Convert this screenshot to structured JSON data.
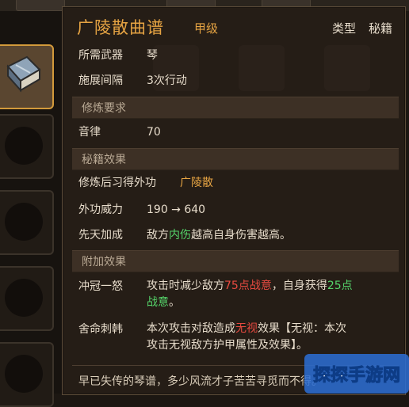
{
  "item": {
    "title": "广陵散曲谱",
    "grade": "甲级",
    "type_label": "类型",
    "type_value": "秘籍"
  },
  "basic": [
    {
      "key": "所需武器",
      "value": "琴"
    },
    {
      "key": "施展间隔",
      "value": "3次行动"
    }
  ],
  "sections": {
    "practice": "修炼要求",
    "secret_effect": "秘籍效果",
    "extra_effect": "附加效果"
  },
  "practice": {
    "key": "音律",
    "value": "70"
  },
  "secret": {
    "learn_key": "修炼后习得外功",
    "learn_value": "广陵散",
    "power_key": "外功威力",
    "power_value": "190 → 640",
    "innate_key": "先天加成",
    "innate_pre": "敌方",
    "innate_hl": "内伤",
    "innate_post": "越高自身伤害越高。"
  },
  "extra": {
    "e1_key": "冲冠一怒",
    "e1_a": "攻击时减少敌方",
    "e1_b": "75点战意",
    "e1_c": "，自身获得",
    "e1_d": "25点",
    "e1_e": "战意",
    "e1_f": "。",
    "e2_key": "舍命刺韩",
    "e2_a": "本次攻击对敌造成",
    "e2_b": "无视",
    "e2_c": "效果【无视：本次",
    "e2_d": "攻击无视敌方护甲属性及效果】。"
  },
  "lore": "早已失传的琴谱，多少风流才子苦苦寻觅而不得。",
  "watermark": "探探手游网",
  "colors": {
    "accent": "#e6a443",
    "green": "#55d46a",
    "red": "#e74a40"
  }
}
